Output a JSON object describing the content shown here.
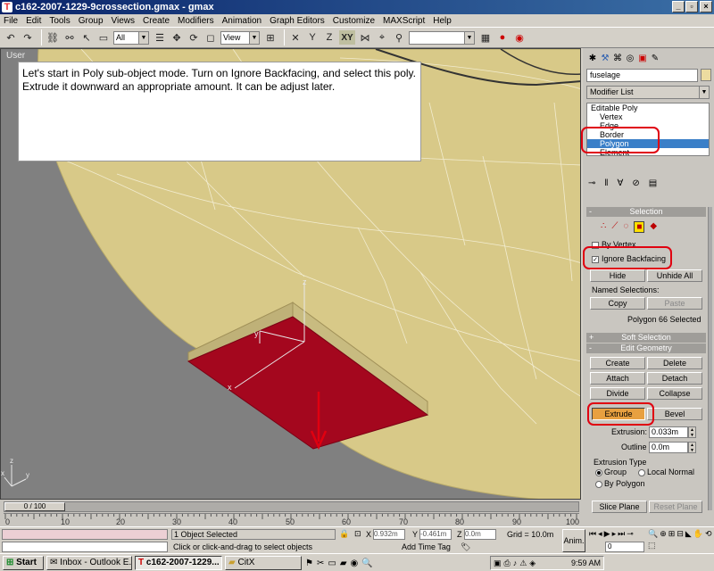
{
  "window": {
    "title": "c162-2007-1229-9crossection.gmax - gmax",
    "logo": "T"
  },
  "menu": [
    "File",
    "Edit",
    "Tools",
    "Group",
    "Views",
    "Create",
    "Modifiers",
    "Animation",
    "Graph Editors",
    "Customize",
    "MAXScript",
    "Help"
  ],
  "toolbar": {
    "selection_filter": "All",
    "ref_coord": "View",
    "axis_label": "XY"
  },
  "viewport": {
    "label": "User",
    "instruction": "Let's start in Poly sub-object mode.  Turn on Ignore Backfacing, and select this poly.  Extrude it downward an appropriate amount.  It can be adjust later.",
    "axis_z": "z",
    "axis_y": "y",
    "axis_x": "x",
    "gizmo_x": "x",
    "gizmo_y": "y",
    "gizmo_z": "z"
  },
  "command_panel": {
    "object_name": "fuselage",
    "modifier_list_label": "Modifier List",
    "stack": [
      "Editable Poly",
      "Vertex",
      "Edge",
      "Border",
      "Polygon",
      "Element"
    ],
    "selected_stack_item": "Polygon",
    "selection_header": "Selection",
    "by_vertex": "By Vertex",
    "ignore_backfacing": "Ignore Backfacing",
    "hide": "Hide",
    "unhide_all": "Unhide All",
    "named_selections": "Named Selections:",
    "copy": "Copy",
    "paste": "Paste",
    "selection_status": "Polygon 66 Selected",
    "soft_selection": "Soft Selection",
    "edit_geometry": "Edit Geometry",
    "create": "Create",
    "delete": "Delete",
    "attach": "Attach",
    "detach": "Detach",
    "divide": "Divide",
    "collapse": "Collapse",
    "extrude": "Extrude",
    "bevel": "Bevel",
    "extrusion_label": "Extrusion:",
    "extrusion_value": "0.033m",
    "outline_label": "Outline",
    "outline_value": "0.0m",
    "extrusion_type_label": "Extrusion Type",
    "group": "Group",
    "local_normal": "Local Normal",
    "by_polygon": "By Polygon",
    "slice_plane": "Slice Plane",
    "reset_plane": "Reset Plane",
    "minus": "-",
    "plus": "+"
  },
  "timeline": {
    "frame_display": "0 / 100",
    "ticks": [
      "0",
      "10",
      "20",
      "30",
      "40",
      "50",
      "60",
      "70",
      "80",
      "90",
      "100"
    ]
  },
  "status": {
    "objects_selected": "1 Object Selected",
    "prompt": "Click or click-and-drag to select objects",
    "x_label": "X",
    "x_value": "0.932m",
    "y_label": "Y",
    "y_value": "-0.461m",
    "z_label": "Z",
    "z_value": "0.0m",
    "grid": "Grid = 10.0m",
    "add_time_tag": "Add Time Tag",
    "anim": "Anim.",
    "frame": "0"
  },
  "taskbar": {
    "start": "Start",
    "tasks": [
      "Inbox - Outlook E...",
      "c162-2007-1229...",
      "CitX"
    ],
    "clock": "9:59 AM"
  },
  "colors": {
    "accent_red": "#e00010",
    "selected_poly": "#a4071e",
    "mesh": "#d8c988",
    "title_bar": "#0a246a"
  }
}
